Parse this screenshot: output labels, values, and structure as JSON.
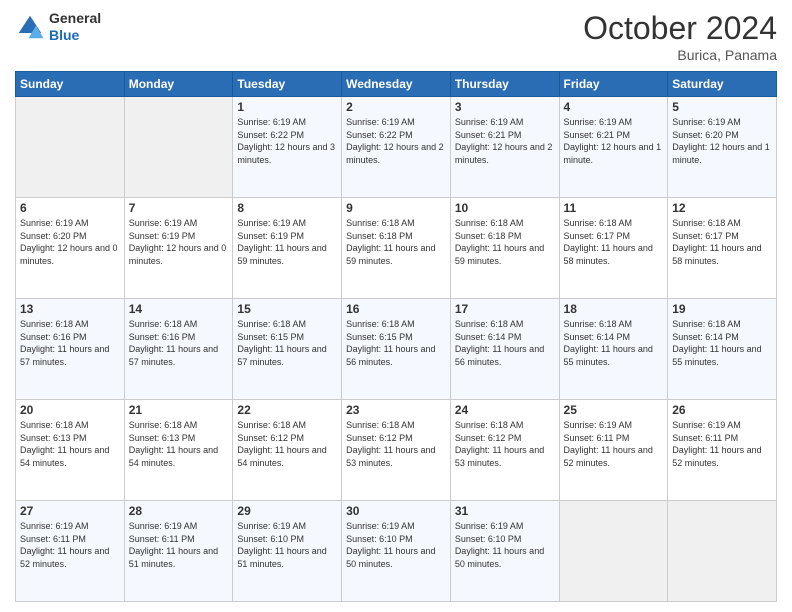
{
  "header": {
    "logo": {
      "general": "General",
      "blue": "Blue"
    },
    "title": "October 2024",
    "location": "Burica, Panama"
  },
  "calendar": {
    "days_of_week": [
      "Sunday",
      "Monday",
      "Tuesday",
      "Wednesday",
      "Thursday",
      "Friday",
      "Saturday"
    ],
    "weeks": [
      [
        {
          "day": "",
          "info": ""
        },
        {
          "day": "",
          "info": ""
        },
        {
          "day": "1",
          "info": "Sunrise: 6:19 AM\nSunset: 6:22 PM\nDaylight: 12 hours and 3 minutes."
        },
        {
          "day": "2",
          "info": "Sunrise: 6:19 AM\nSunset: 6:22 PM\nDaylight: 12 hours and 2 minutes."
        },
        {
          "day": "3",
          "info": "Sunrise: 6:19 AM\nSunset: 6:21 PM\nDaylight: 12 hours and 2 minutes."
        },
        {
          "day": "4",
          "info": "Sunrise: 6:19 AM\nSunset: 6:21 PM\nDaylight: 12 hours and 1 minute."
        },
        {
          "day": "5",
          "info": "Sunrise: 6:19 AM\nSunset: 6:20 PM\nDaylight: 12 hours and 1 minute."
        }
      ],
      [
        {
          "day": "6",
          "info": "Sunrise: 6:19 AM\nSunset: 6:20 PM\nDaylight: 12 hours and 0 minutes."
        },
        {
          "day": "7",
          "info": "Sunrise: 6:19 AM\nSunset: 6:19 PM\nDaylight: 12 hours and 0 minutes."
        },
        {
          "day": "8",
          "info": "Sunrise: 6:19 AM\nSunset: 6:19 PM\nDaylight: 11 hours and 59 minutes."
        },
        {
          "day": "9",
          "info": "Sunrise: 6:18 AM\nSunset: 6:18 PM\nDaylight: 11 hours and 59 minutes."
        },
        {
          "day": "10",
          "info": "Sunrise: 6:18 AM\nSunset: 6:18 PM\nDaylight: 11 hours and 59 minutes."
        },
        {
          "day": "11",
          "info": "Sunrise: 6:18 AM\nSunset: 6:17 PM\nDaylight: 11 hours and 58 minutes."
        },
        {
          "day": "12",
          "info": "Sunrise: 6:18 AM\nSunset: 6:17 PM\nDaylight: 11 hours and 58 minutes."
        }
      ],
      [
        {
          "day": "13",
          "info": "Sunrise: 6:18 AM\nSunset: 6:16 PM\nDaylight: 11 hours and 57 minutes."
        },
        {
          "day": "14",
          "info": "Sunrise: 6:18 AM\nSunset: 6:16 PM\nDaylight: 11 hours and 57 minutes."
        },
        {
          "day": "15",
          "info": "Sunrise: 6:18 AM\nSunset: 6:15 PM\nDaylight: 11 hours and 57 minutes."
        },
        {
          "day": "16",
          "info": "Sunrise: 6:18 AM\nSunset: 6:15 PM\nDaylight: 11 hours and 56 minutes."
        },
        {
          "day": "17",
          "info": "Sunrise: 6:18 AM\nSunset: 6:14 PM\nDaylight: 11 hours and 56 minutes."
        },
        {
          "day": "18",
          "info": "Sunrise: 6:18 AM\nSunset: 6:14 PM\nDaylight: 11 hours and 55 minutes."
        },
        {
          "day": "19",
          "info": "Sunrise: 6:18 AM\nSunset: 6:14 PM\nDaylight: 11 hours and 55 minutes."
        }
      ],
      [
        {
          "day": "20",
          "info": "Sunrise: 6:18 AM\nSunset: 6:13 PM\nDaylight: 11 hours and 54 minutes."
        },
        {
          "day": "21",
          "info": "Sunrise: 6:18 AM\nSunset: 6:13 PM\nDaylight: 11 hours and 54 minutes."
        },
        {
          "day": "22",
          "info": "Sunrise: 6:18 AM\nSunset: 6:12 PM\nDaylight: 11 hours and 54 minutes."
        },
        {
          "day": "23",
          "info": "Sunrise: 6:18 AM\nSunset: 6:12 PM\nDaylight: 11 hours and 53 minutes."
        },
        {
          "day": "24",
          "info": "Sunrise: 6:18 AM\nSunset: 6:12 PM\nDaylight: 11 hours and 53 minutes."
        },
        {
          "day": "25",
          "info": "Sunrise: 6:19 AM\nSunset: 6:11 PM\nDaylight: 11 hours and 52 minutes."
        },
        {
          "day": "26",
          "info": "Sunrise: 6:19 AM\nSunset: 6:11 PM\nDaylight: 11 hours and 52 minutes."
        }
      ],
      [
        {
          "day": "27",
          "info": "Sunrise: 6:19 AM\nSunset: 6:11 PM\nDaylight: 11 hours and 52 minutes."
        },
        {
          "day": "28",
          "info": "Sunrise: 6:19 AM\nSunset: 6:11 PM\nDaylight: 11 hours and 51 minutes."
        },
        {
          "day": "29",
          "info": "Sunrise: 6:19 AM\nSunset: 6:10 PM\nDaylight: 11 hours and 51 minutes."
        },
        {
          "day": "30",
          "info": "Sunrise: 6:19 AM\nSunset: 6:10 PM\nDaylight: 11 hours and 50 minutes."
        },
        {
          "day": "31",
          "info": "Sunrise: 6:19 AM\nSunset: 6:10 PM\nDaylight: 11 hours and 50 minutes."
        },
        {
          "day": "",
          "info": ""
        },
        {
          "day": "",
          "info": ""
        }
      ]
    ]
  }
}
